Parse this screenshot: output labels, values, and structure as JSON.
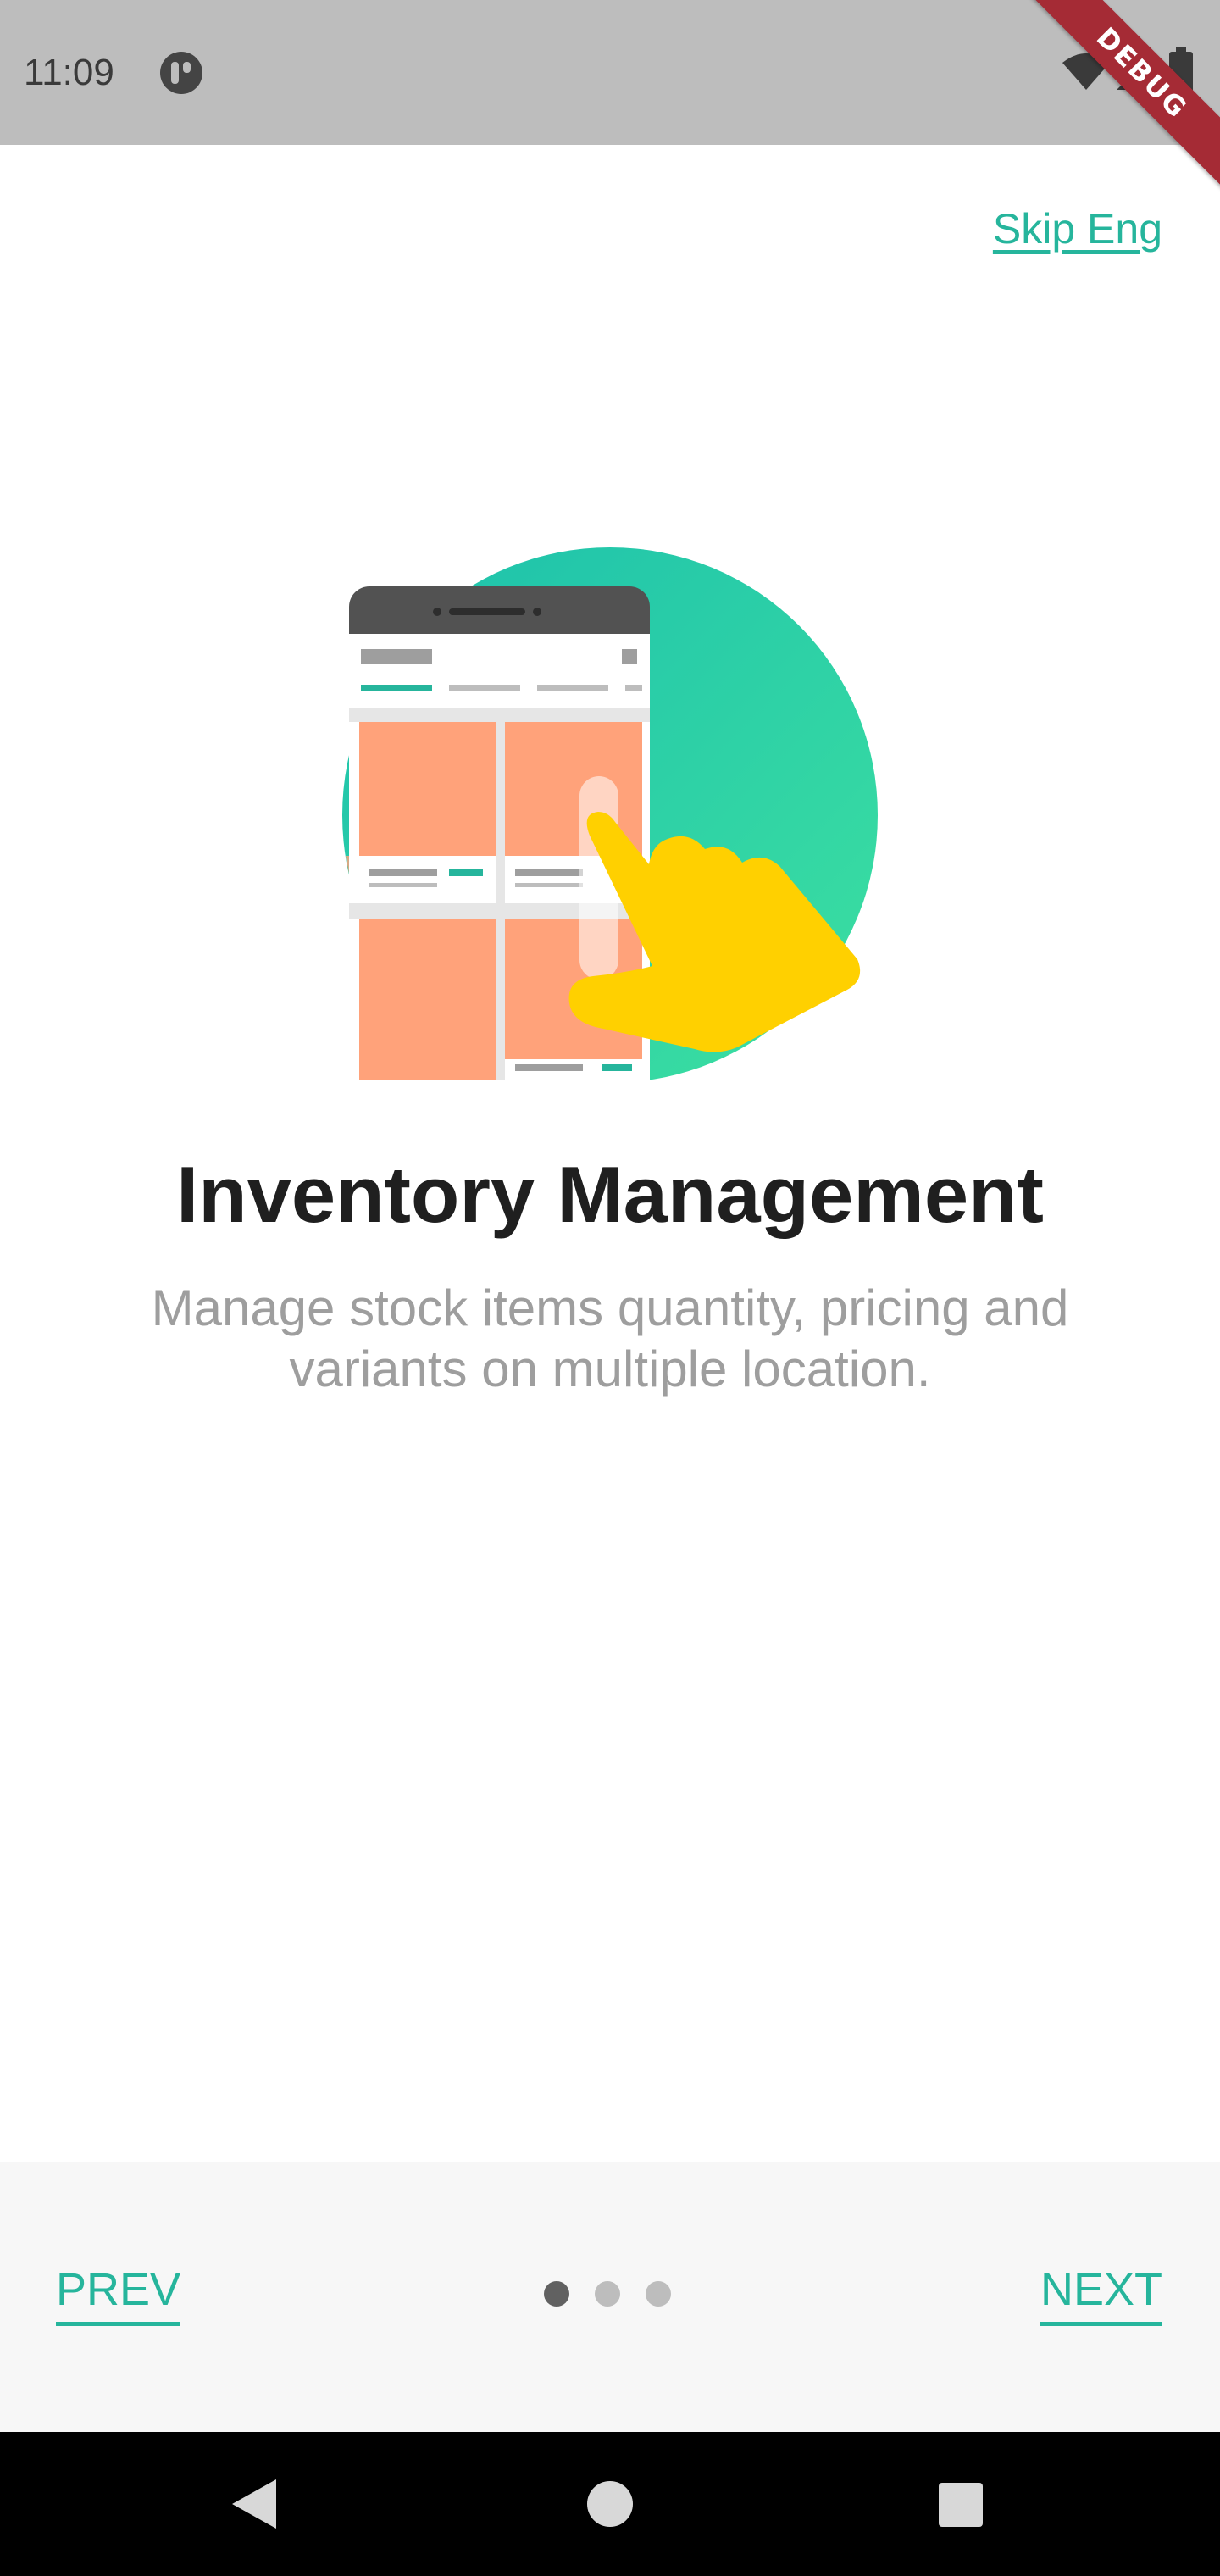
{
  "status_bar": {
    "time": "11:09",
    "app_icon": "media-indicator-icon",
    "wifi_icon": "wifi-icon",
    "signal_icon": "cell-signal-icon",
    "battery_icon": "battery-icon",
    "debug_label": "DEBUG",
    "debug_color": "#a52b35"
  },
  "header": {
    "skip_label": "Skip Eng"
  },
  "slide": {
    "illustration": "inventory-phone-hand-illustration",
    "title": "Inventory Management",
    "description": "Manage stock items quantity, pricing and variants on multiple location."
  },
  "navigation": {
    "prev_label": "PREV",
    "next_label": "NEXT",
    "page_count": 3,
    "current_page": 1
  },
  "system_nav": {
    "back_icon": "back-triangle-icon",
    "home_icon": "home-circle-icon",
    "recents_icon": "recents-square-icon"
  },
  "colors": {
    "accent": "#26b59c",
    "status_bar_bg": "#bdbdbd",
    "title_text": "#1f1f1f",
    "description_text": "#9e9e9e",
    "bottom_nav_bg": "#f7f7f7",
    "dot_active": "#616161",
    "dot_inactive": "#bdbdbd"
  }
}
